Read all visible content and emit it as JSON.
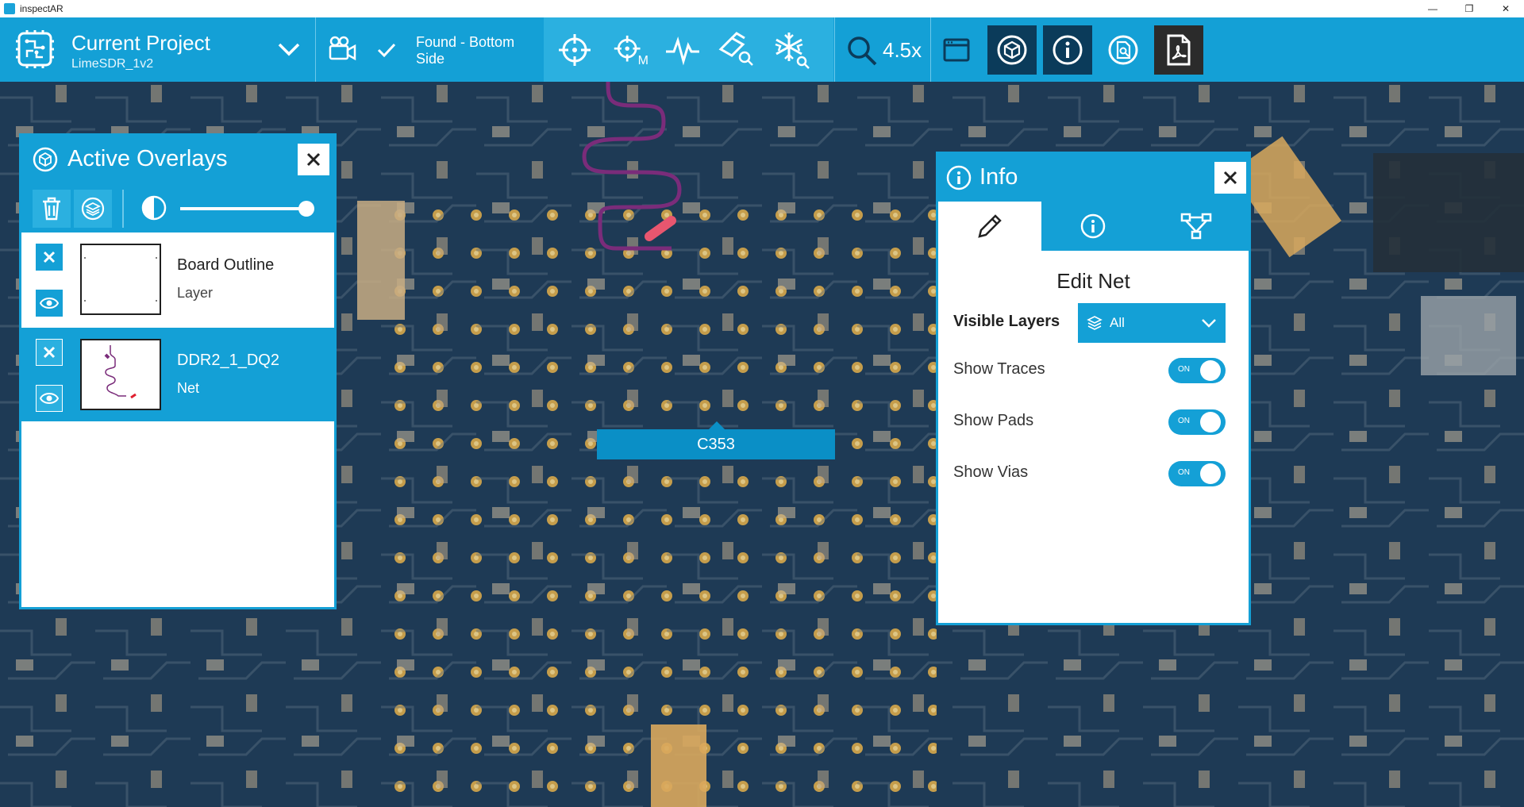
{
  "window": {
    "title": "inspectAR",
    "controls": [
      "—",
      "❐",
      "✕"
    ]
  },
  "toolbar": {
    "project_title": "Current Project",
    "project_name": "LimeSDR_1v2",
    "status_text": "Found - Bottom Side",
    "zoom_level": "4.5x",
    "tool_sub_m": "M"
  },
  "overlays_panel": {
    "title": "Active Overlays",
    "opacity": 1.0,
    "items": [
      {
        "name": "Board Outline",
        "type": "Layer",
        "selected": false
      },
      {
        "name": "DDR2_1_DQ2",
        "type": "Net",
        "selected": true
      }
    ]
  },
  "component_label": "C353",
  "info_panel": {
    "title": "Info",
    "edit_title": "Edit Net",
    "visible_layers_label": "Visible Layers",
    "visible_layers_value": "All",
    "toggles": [
      {
        "label": "Show Traces",
        "state": "ON"
      },
      {
        "label": "Show Pads",
        "state": "ON"
      },
      {
        "label": "Show Vias",
        "state": "ON"
      }
    ]
  },
  "colors": {
    "accent": "#14a0d6",
    "accent_light": "#2bb0e0",
    "dark_button": "#0b3b5a",
    "board": "#1e3a55",
    "net_trace": "#7a2c7a",
    "net_pad": "#e8566f"
  }
}
